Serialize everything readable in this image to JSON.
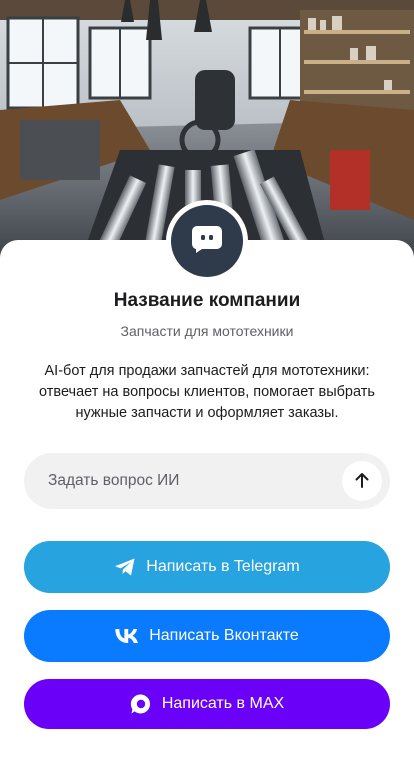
{
  "company": {
    "name": "Название компании",
    "tagline": "Запчасти для мототехники",
    "description": "AI-бот для продажи запчастей для мототехники: отвечает на вопросы клиентов, помогает выбрать нужные запчасти и оформляет заказы."
  },
  "hero": {
    "image": "motorcycle-workshop-photo",
    "avatar_icon": "chat-bot-icon"
  },
  "ask": {
    "placeholder": "Задать вопрос ИИ",
    "value": "",
    "send_icon": "arrow-up-icon"
  },
  "buttons": {
    "telegram": {
      "label": "Написать в Telegram",
      "icon": "telegram-icon",
      "color": "#27a3e0"
    },
    "vk": {
      "label": "Написать Вконтакте",
      "icon": "vk-icon",
      "color": "#0a7aff"
    },
    "max": {
      "label": "Написать в MAX",
      "icon": "max-icon",
      "color": "#6a00f7"
    }
  }
}
